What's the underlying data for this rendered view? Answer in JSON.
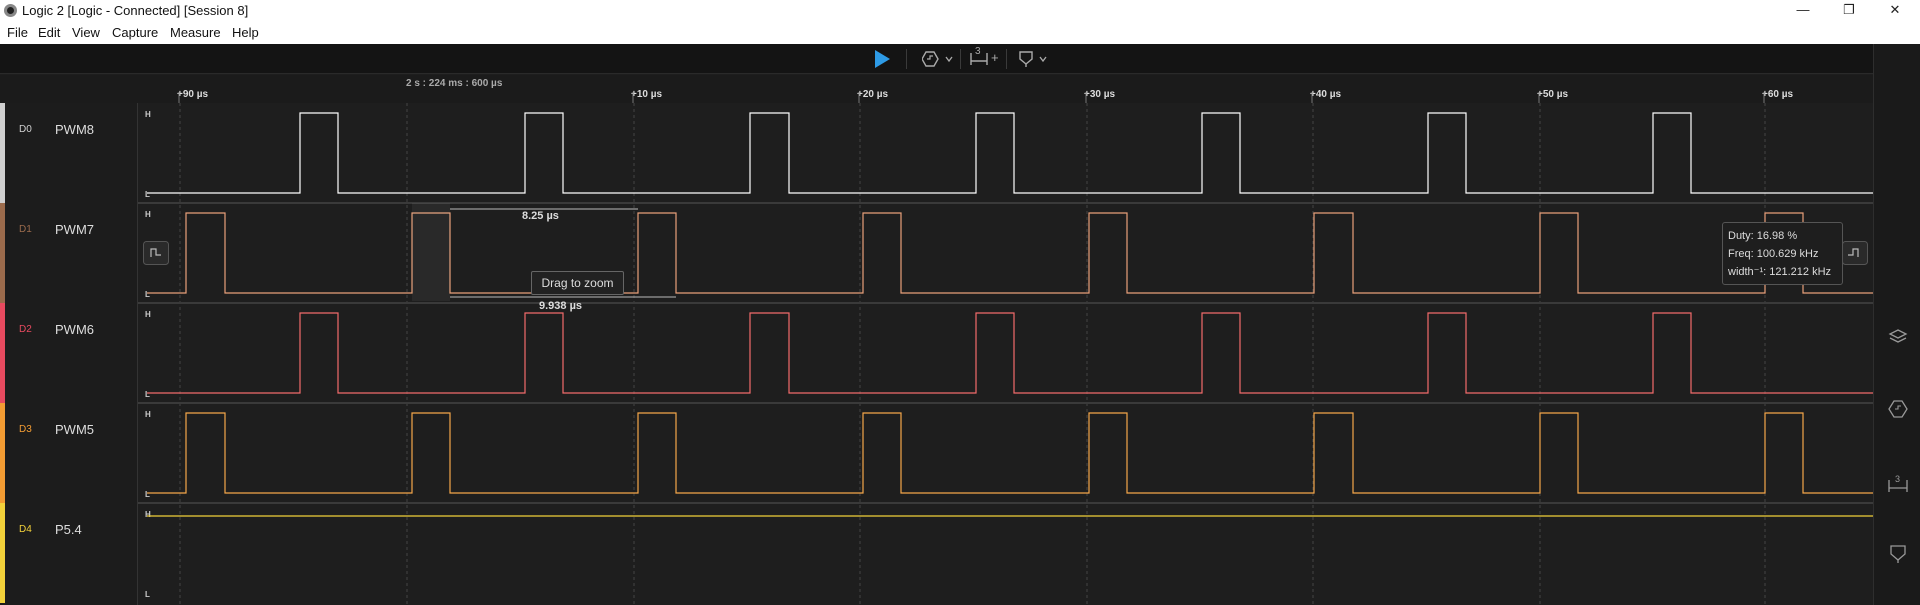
{
  "window": {
    "title": "Logic 2 [Logic - Connected] [Session 8]",
    "minimize": "—",
    "restore": "❐",
    "close": "✕"
  },
  "menu": [
    "File",
    "Edit",
    "View",
    "Capture",
    "Measure",
    "Help"
  ],
  "toolbar": {
    "play_icon": "play-icon",
    "trigger_icon": "trigger-icon",
    "measure_count": "3",
    "measure_add": "+",
    "marker_icon": "marker-icon",
    "dropdown": "⌄"
  },
  "ruler": {
    "reference_time": "2 s : 224 ms : 600 µs",
    "ticks": [
      "+90 µs",
      "+10 µs",
      "+20 µs",
      "+30 µs",
      "+40 µs",
      "+50 µs",
      "+60 µs"
    ]
  },
  "channels": [
    {
      "id": "D0",
      "name": "PWM8",
      "color": "#ffffff",
      "bar_color": "#d0d0d0",
      "high": "H",
      "low": "L"
    },
    {
      "id": "D1",
      "name": "PWM7",
      "color": "#e8a07a",
      "bar_color": "#9b6b4c",
      "high": "H",
      "low": "L"
    },
    {
      "id": "D2",
      "name": "PWM6",
      "color": "#f26b6b",
      "bar_color": "#e84a5f",
      "high": "H",
      "low": "L"
    },
    {
      "id": "D3",
      "name": "PWM5",
      "color": "#f5a64a",
      "bar_color": "#f39c33",
      "high": "H",
      "low": "L"
    },
    {
      "id": "D4",
      "name": "P5.4",
      "color": "#f2d13a",
      "bar_color": "#f2d13a",
      "high": "H",
      "low": "L"
    }
  ],
  "measurements": {
    "width_label": "8.25 µs",
    "period_label": "9.938 µs",
    "drag_tip": "Drag to zoom"
  },
  "tooltip": {
    "duty": "Duty: 16.98 %",
    "freq": "Freq: 100.629 kHz",
    "width": "width⁻¹: 121.212 kHz"
  },
  "right_sidebar": [
    "analyzers-icon",
    "extensions-icon",
    "measurements-icon",
    "markers-icon"
  ],
  "colors": {
    "accent": "#2e9be6",
    "background": "#1e1e1e"
  }
}
